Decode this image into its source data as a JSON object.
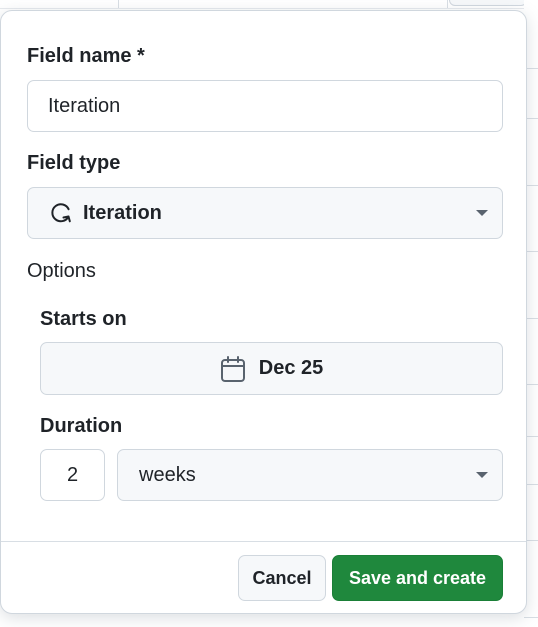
{
  "form": {
    "field_name_label": "Field name *",
    "field_name_value": "Iteration",
    "field_type_label": "Field type",
    "field_type_value": "Iteration",
    "field_type_icon": "iteration-icon",
    "options_label": "Options",
    "starts_on_label": "Starts on",
    "starts_on_value": "Dec 25",
    "starts_on_icon": "calendar-icon",
    "duration_label": "Duration",
    "duration_value": "2",
    "duration_unit": "weeks"
  },
  "footer": {
    "cancel_label": "Cancel",
    "submit_label": "Save and create"
  },
  "colors": {
    "primary": "#1f883d",
    "border": "#d0d7de",
    "text": "#1f2328",
    "muted": "#59636e"
  }
}
